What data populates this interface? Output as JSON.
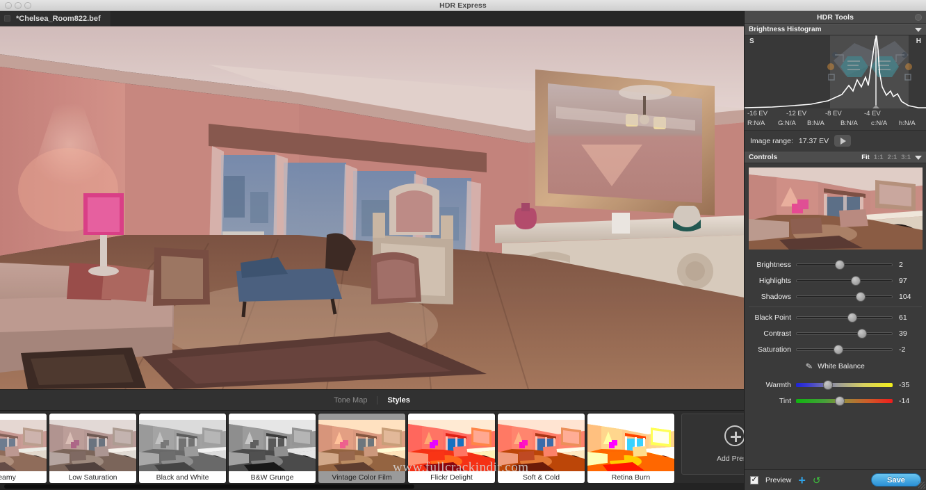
{
  "window": {
    "title": "HDR Express",
    "traffic_lights": [
      "close-light",
      "minimize-light",
      "zoom-light"
    ]
  },
  "document_tab": {
    "label": "*Chelsea_Room822.bef",
    "close_icon": "close-box-icon"
  },
  "bottom_tabs": [
    {
      "label": "Tone Map",
      "active": false
    },
    {
      "label": "Styles",
      "active": true
    }
  ],
  "presets": {
    "items": [
      {
        "label": "Dreamy",
        "selected": false,
        "style": "dreamy"
      },
      {
        "label": "Low Saturation",
        "selected": false,
        "style": "lowsat"
      },
      {
        "label": "Black and White",
        "selected": false,
        "style": "bw"
      },
      {
        "label": "B&W Grunge",
        "selected": false,
        "style": "bwgrunge"
      },
      {
        "label": "Vintage Color Film",
        "selected": true,
        "style": "vintage"
      },
      {
        "label": "Flickr Delight",
        "selected": false,
        "style": "flickr"
      },
      {
        "label": "Soft & Cold",
        "selected": false,
        "style": "softcold"
      },
      {
        "label": "Retina Burn",
        "selected": false,
        "style": "retina"
      }
    ],
    "add_label": "Add Preset",
    "add_icon": "plus-circle-icon"
  },
  "panel": {
    "title": "HDR Tools",
    "close_icon": "panel-close-icon",
    "histogram": {
      "section_label": "Brightness Histogram",
      "collapse_icon": "caret-down-icon",
      "shadow_marker": "S",
      "highlight_marker": "H",
      "ev_ticks": [
        "-16 EV",
        "-12 EV",
        "-8 EV",
        "-4 EV"
      ],
      "readouts": [
        "R:N/A",
        "G:N/A",
        "B:N/A",
        "B:N/A",
        "c:N/A",
        "h:N/A"
      ],
      "image_range_label": "Image range:",
      "image_range_value": "17.37 EV",
      "play_icon": "play-triangle-icon"
    },
    "controls": {
      "section_label": "Controls",
      "zoom_options": [
        {
          "label": "Fit",
          "active": true
        },
        {
          "label": "1:1",
          "active": false
        },
        {
          "label": "2:1",
          "active": false
        },
        {
          "label": "3:1",
          "active": false
        }
      ],
      "collapse_icon": "caret-down-icon",
      "sliders": [
        {
          "label": "Brightness",
          "value": "2",
          "pos": 45
        },
        {
          "label": "Highlights",
          "value": "97",
          "pos": 62
        },
        {
          "label": "Shadows",
          "value": "104",
          "pos": 67
        },
        {
          "label": "Black Point",
          "value": "61",
          "pos": 58
        },
        {
          "label": "Contrast",
          "value": "39",
          "pos": 68
        },
        {
          "label": "Saturation",
          "value": "-2",
          "pos": 44
        }
      ],
      "white_balance": {
        "label": "White Balance",
        "eyedropper_icon": "eyedropper-icon",
        "sliders": [
          {
            "label": "Warmth",
            "value": "-35",
            "pos": 33,
            "kind": "warm"
          },
          {
            "label": "Tint",
            "value": "-14",
            "pos": 45,
            "kind": "tint"
          }
        ]
      }
    },
    "footer": {
      "preview_label": "Preview",
      "preview_checked": true,
      "checkbox_icon": "checkbox-checked-icon",
      "add_icon": "plus-icon",
      "reset_icon": "refresh-icon",
      "save_label": "Save"
    }
  },
  "overlay": {
    "watermark": "www.fullcrackindir.com"
  }
}
